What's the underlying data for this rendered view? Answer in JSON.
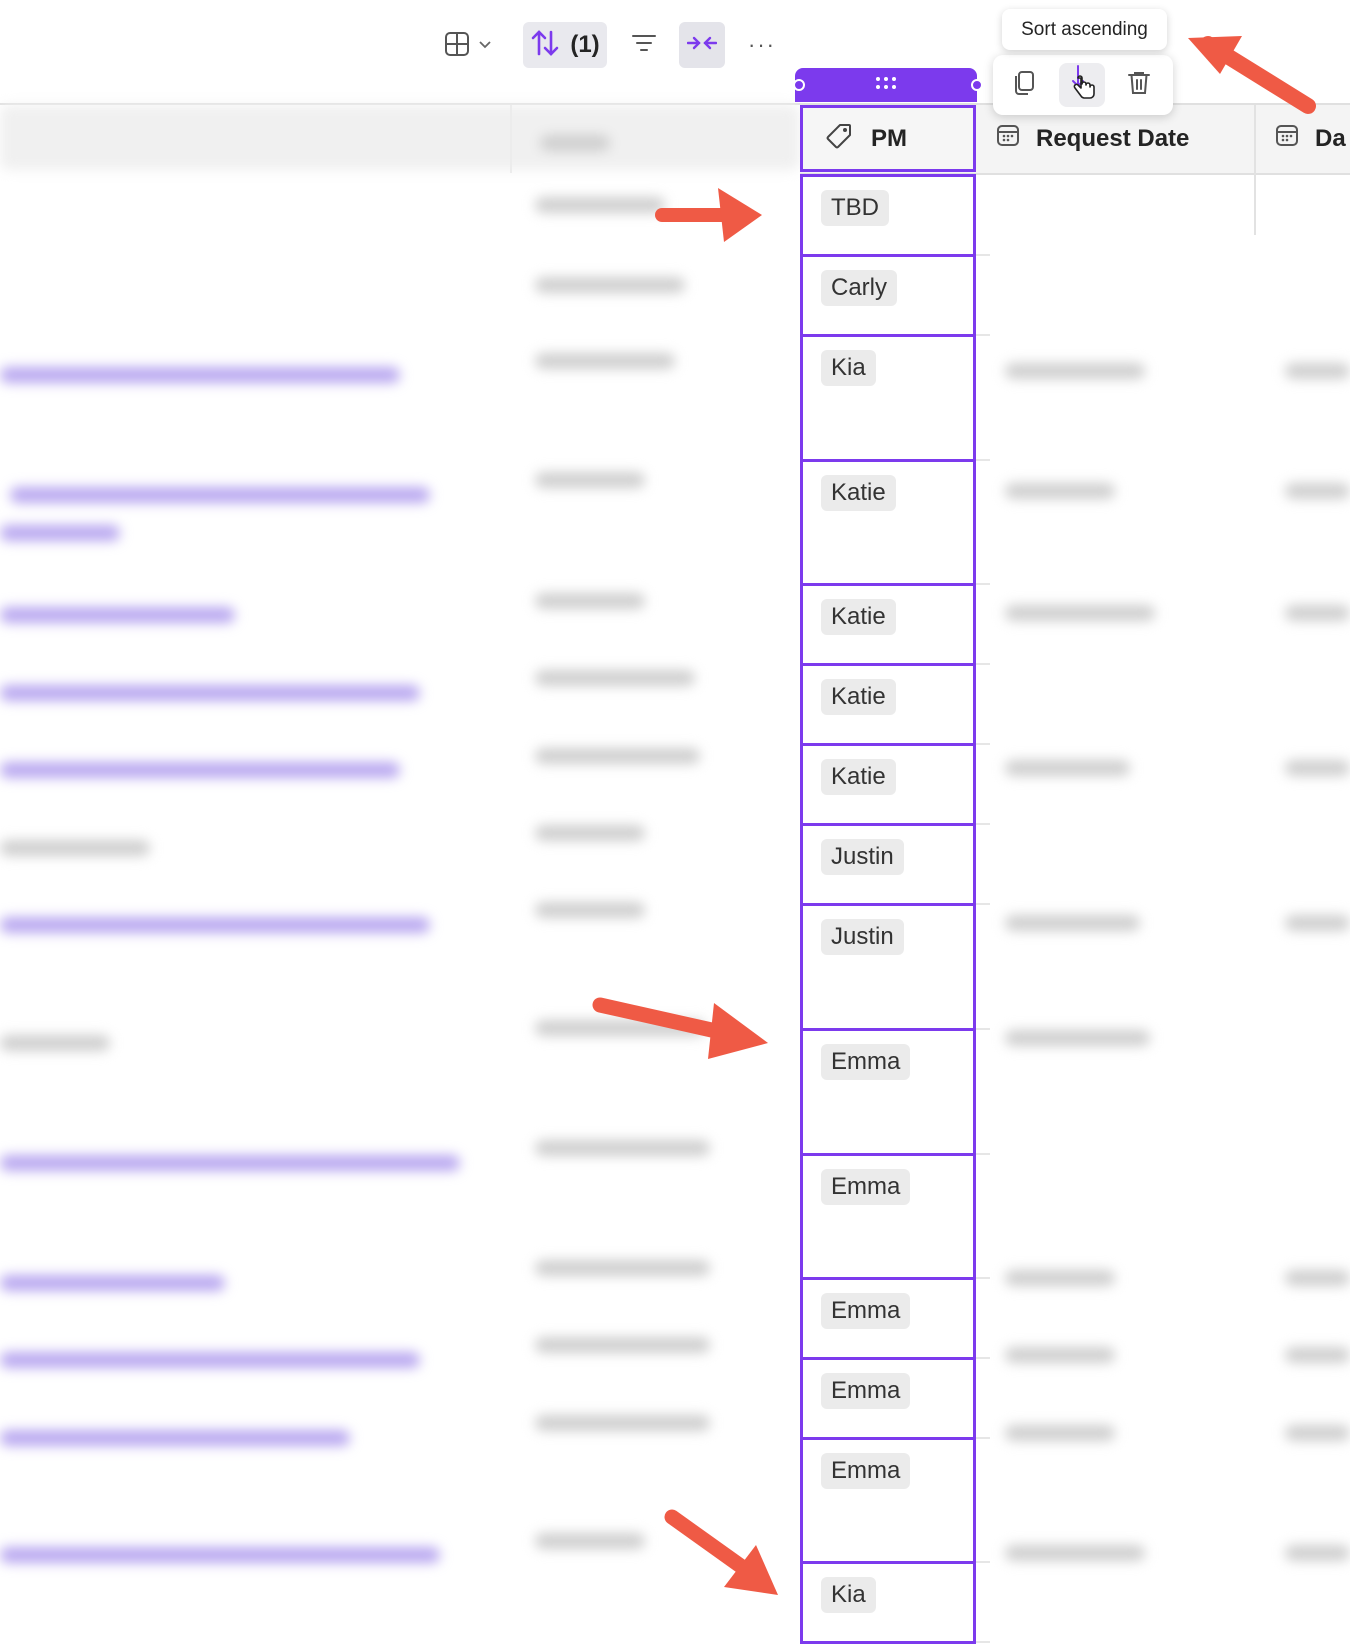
{
  "toolbar": {
    "sort_count": "(1)",
    "more_label": "···",
    "icons": [
      "table-view-icon",
      "chevron-down-icon",
      "sort-icon",
      "filter-icon",
      "collapse-icon",
      "more-icon"
    ]
  },
  "tooltip": {
    "text": "Sort ascending"
  },
  "column_actions": {
    "icons": [
      "copy-icon",
      "sort-ascending-icon",
      "delete-icon"
    ]
  },
  "columns": {
    "pm": {
      "label": "PM",
      "icon": "tag-icon"
    },
    "request_date": {
      "label": "Request Date",
      "icon": "calendar-icon"
    },
    "date2": {
      "label": "Da",
      "icon": "calendar-icon"
    }
  },
  "pm_rows": [
    {
      "value": "TBD"
    },
    {
      "value": "Carly"
    },
    {
      "value": "Kia"
    },
    {
      "value": "Katie"
    },
    {
      "value": "Katie"
    },
    {
      "value": "Katie"
    },
    {
      "value": "Katie"
    },
    {
      "value": "Justin"
    },
    {
      "value": "Justin"
    },
    {
      "value": "Emma"
    },
    {
      "value": "Emma"
    },
    {
      "value": "Emma"
    },
    {
      "value": "Emma"
    },
    {
      "value": "Emma"
    },
    {
      "value": "Kia"
    }
  ],
  "colors": {
    "accent": "#7c3aed",
    "annotation_arrow": "#ef5a45",
    "tag_background": "#ebebeb"
  }
}
